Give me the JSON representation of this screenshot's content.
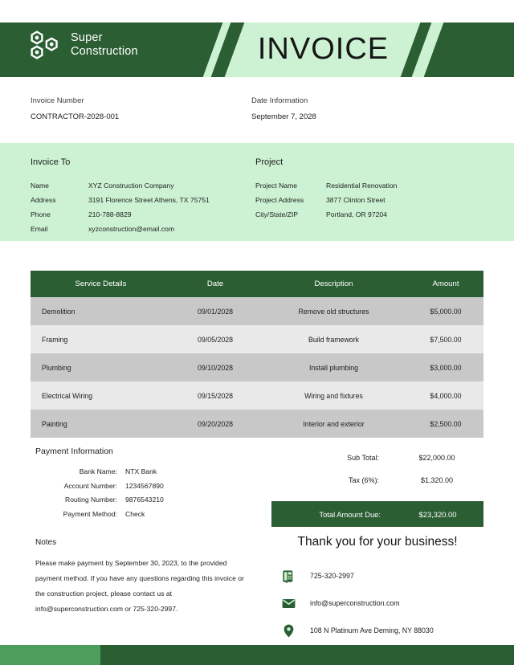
{
  "brand": {
    "name_line1": "Super",
    "name_line2": "Construction",
    "logo_icon": "hex-nuts-logo-icon",
    "dark_green": "#2c5e34",
    "light_green": "#cdf2d3",
    "footer_light_green": "#4d9e5d",
    "row_dark": "#c8c8c8",
    "row_light": "#e9e9e9"
  },
  "header": {
    "title": "INVOICE"
  },
  "meta": {
    "invoice_number_label": "Invoice Number",
    "invoice_number_value": "CONTRACTOR-2028-001",
    "date_label": "Date Information",
    "date_value": "September 7, 2028"
  },
  "invoice_to": {
    "title": "Invoice To",
    "rows": [
      {
        "label": "Name",
        "value": "XYZ Construction Company"
      },
      {
        "label": "Address",
        "value": "3191 Florence Street Athens, TX 75751"
      },
      {
        "label": "Phone",
        "value": "210-788-8829"
      },
      {
        "label": "Email",
        "value": "xyzconstruction@email.com"
      }
    ]
  },
  "project": {
    "title": "Project",
    "rows": [
      {
        "label": "Project Name",
        "value": "Residential Renovation"
      },
      {
        "label": "Project Address",
        "value": "3877 Clinton Street"
      },
      {
        "label": "City/State/ZIP",
        "value": "Portland, OR 97204"
      }
    ]
  },
  "table": {
    "columns": [
      "Service Details",
      "Date",
      "Description",
      "Amount"
    ],
    "rows": [
      {
        "service": "Demolition",
        "date": "09/01/2028",
        "description": "Remove old structures",
        "amount": "$5,000.00"
      },
      {
        "service": "Framing",
        "date": "09/05/2028",
        "description": "Build framework",
        "amount": "$7,500.00"
      },
      {
        "service": "Plumbing",
        "date": "09/10/2028",
        "description": "Install plumbing",
        "amount": "$3,000.00"
      },
      {
        "service": "Electrical Wiring",
        "date": "09/15/2028",
        "description": "Wiring and fixtures",
        "amount": "$4,000.00"
      },
      {
        "service": "Painting",
        "date": "09/20/2028",
        "description": "Interior and exterior",
        "amount": "$2,500.00"
      }
    ]
  },
  "payment": {
    "title": "Payment Information",
    "rows": [
      {
        "label": "Bank Name:",
        "value": "NTX Bank"
      },
      {
        "label": "Account Number:",
        "value": "1234567890"
      },
      {
        "label": "Routing Number:",
        "value": "9876543210"
      },
      {
        "label": "Payment Method:",
        "value": "Check"
      }
    ]
  },
  "totals": {
    "subtotal_label": "Sub Total:",
    "subtotal_value": "$22,000.00",
    "tax_label": "Tax (6%):",
    "tax_value": "$1,320.00",
    "total_label": "Total Amount Due:",
    "total_value": "$23,320.00"
  },
  "notes": {
    "title": "Notes",
    "body": "Please make payment by September 30, 2023, to the provided payment method. If you have any questions regarding this invoice or the construction project, please contact us at info@superconstruction.com or 725-320-2997."
  },
  "footer_block": {
    "thanks": "Thank you for your business!",
    "contacts": [
      {
        "icon": "desk-phone-icon",
        "text": "725-320-2997"
      },
      {
        "icon": "envelope-icon",
        "text": "info@superconstruction.com"
      },
      {
        "icon": "map-pin-icon",
        "text": "108 N Platinum Ave Deming, NY 88030"
      }
    ]
  }
}
